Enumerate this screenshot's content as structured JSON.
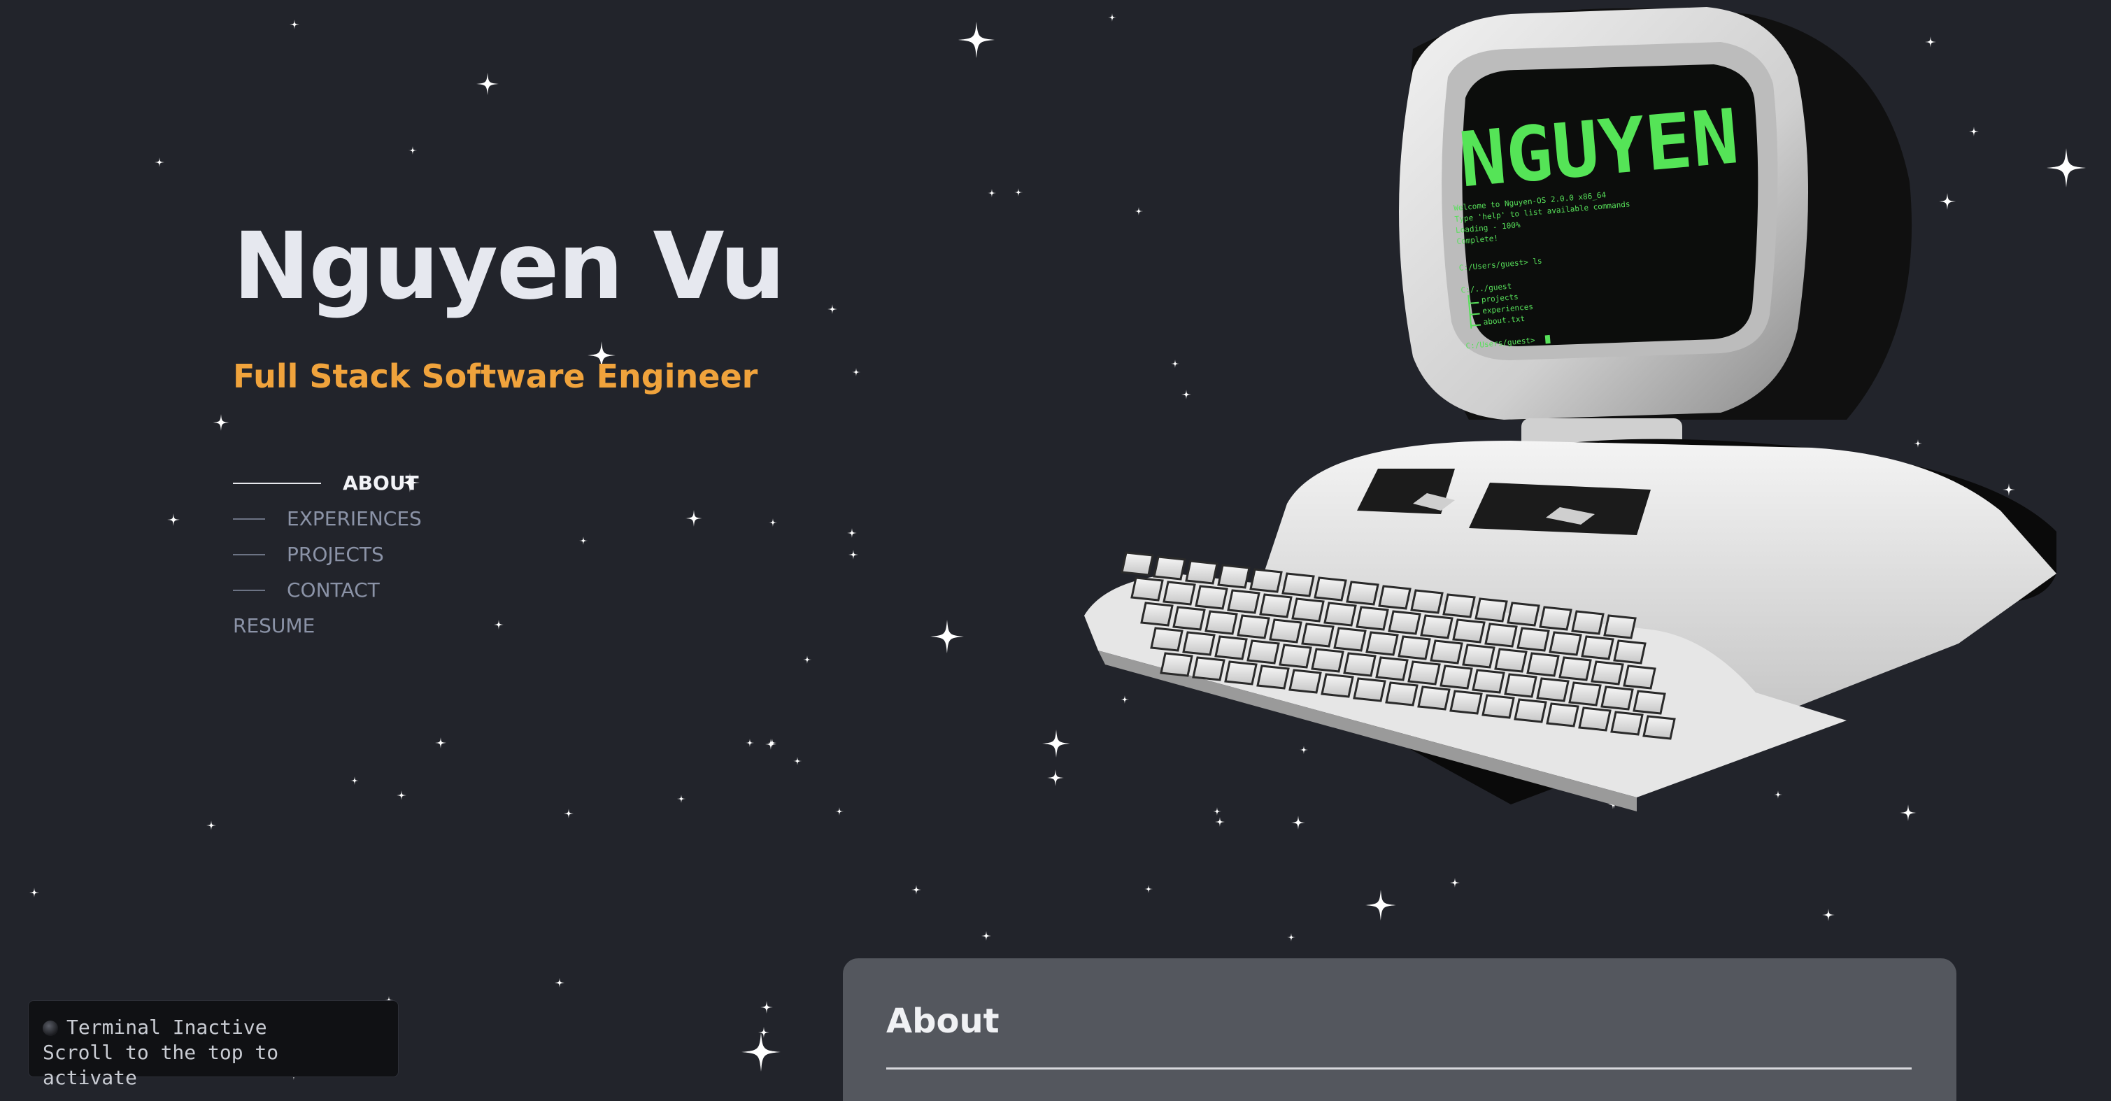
{
  "hero": {
    "name": "Nguyen Vu",
    "subtitle": "Full Stack Software Engineer"
  },
  "nav": {
    "items": [
      {
        "label": "ABOUT",
        "active": true
      },
      {
        "label": "EXPERIENCES",
        "active": false
      },
      {
        "label": "PROJECTS",
        "active": false
      },
      {
        "label": "CONTACT",
        "active": false
      },
      {
        "label": "RESUME",
        "active": false
      }
    ]
  },
  "terminal_status": {
    "title": "Terminal Inactive",
    "hint": "Scroll to the top to activate"
  },
  "computer_screen": {
    "logo": "NGUYEN",
    "lines": [
      "Welcome to Nguyen-OS 2.0.0 x86_64",
      "Type 'help' to list available commands",
      "Loading - 100%",
      "Complete!",
      "C:/Users/guest> ls",
      "C:/../guest",
      "projects",
      "experiences",
      "about.txt",
      "C:/Users/guest>"
    ]
  },
  "about": {
    "title": "About"
  },
  "colors": {
    "background": "#22242b",
    "accent": "#f0a33c",
    "terminal_green": "#57e05a",
    "card": "#54575e"
  },
  "icons": {
    "status_dot": "status-dot-icon",
    "stars": "sparkle-star-icon"
  }
}
